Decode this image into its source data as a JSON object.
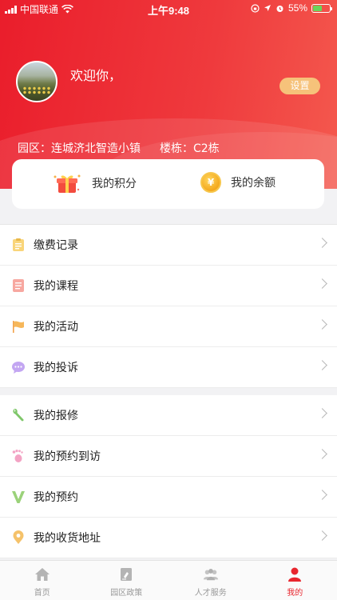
{
  "status_bar": {
    "carrier": "中国联通",
    "time": "上午9:48",
    "battery": "55%",
    "battery_level": 0.55
  },
  "profile": {
    "greeting": "欢迎你，",
    "settings_label": "设置"
  },
  "park_info": {
    "park": "园区：连城济北智造小镇",
    "building": "楼栋：C2栋"
  },
  "card": {
    "points_label": "我的积分",
    "balance_label": "我的余额",
    "coin_symbol": "¥"
  },
  "menu_group1": [
    {
      "label": "缴费记录",
      "icon": "clipboard-icon"
    },
    {
      "label": "我的课程",
      "icon": "document-icon"
    },
    {
      "label": "我的活动",
      "icon": "flag-icon"
    },
    {
      "label": "我的投诉",
      "icon": "chat-bubble-icon"
    }
  ],
  "menu_group2": [
    {
      "label": "我的报修",
      "icon": "wrench-icon"
    },
    {
      "label": "我的预约到访",
      "icon": "footprint-icon"
    },
    {
      "label": "我的预约",
      "icon": "v-icon"
    },
    {
      "label": "我的收货地址",
      "icon": "location-pin-icon"
    }
  ],
  "tabbar": {
    "home": "首页",
    "policy": "园区政策",
    "talent": "人才服务",
    "mine": "我的"
  },
  "colors": {
    "brand_red": "#e8262e",
    "settings_button": "#f6c27a"
  }
}
